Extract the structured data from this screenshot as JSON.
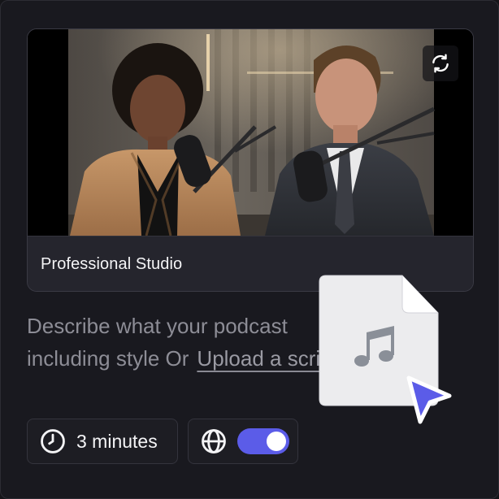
{
  "card": {
    "title": "Professional Studio",
    "thumbnail_alt": "Two podcast hosts in a professional studio",
    "swap_icon": "swap-icon"
  },
  "description": {
    "line1": "Describe what your podcast",
    "line2_prefix": "including style Or",
    "upload_link": "Upload a script."
  },
  "file_drop": {
    "icon": "music-file-icon",
    "cursor_icon": "cursor-arrow-icon",
    "accent": "#5b5ce8"
  },
  "controls": {
    "duration_icon": "clock-icon",
    "duration_label": "3 minutes",
    "language_icon": "globe-icon",
    "language_toggle": true
  },
  "colors": {
    "background": "#19191f",
    "card": "#25252d",
    "accent": "#5b5ce8",
    "muted_text": "#8d8d96"
  }
}
